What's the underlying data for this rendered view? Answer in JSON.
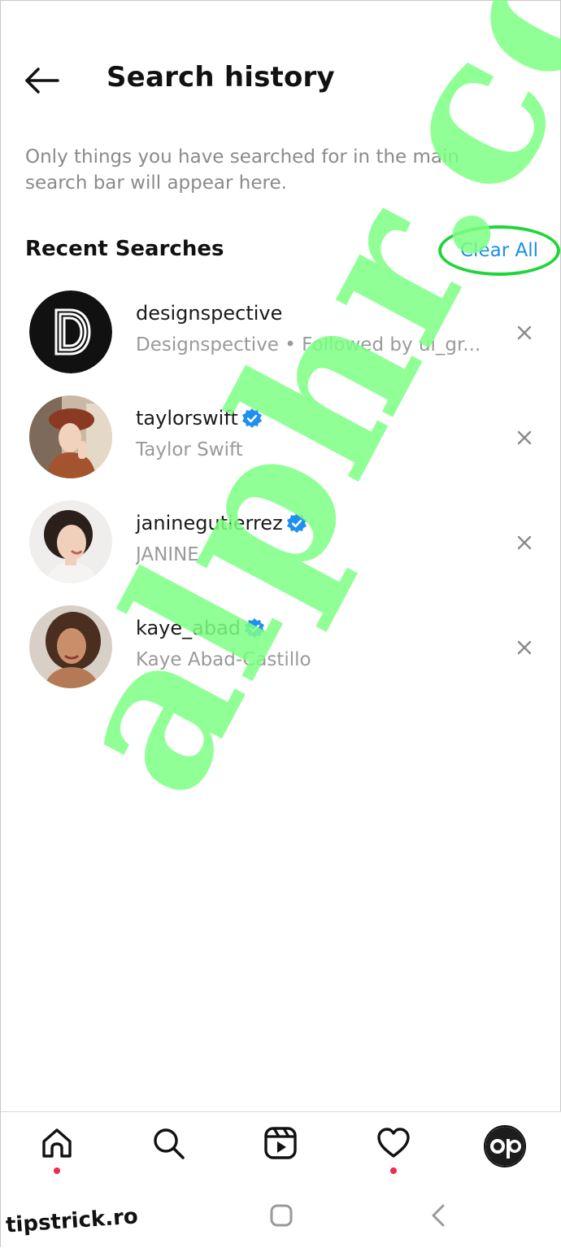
{
  "header": {
    "title": "Search history",
    "back_icon": "arrow-left-icon"
  },
  "description": "Only things you have searched for in the main search bar will appear here.",
  "recent": {
    "title": "Recent Searches",
    "clear_all_label": "Clear All",
    "accent_color": "#1a8fe0",
    "highlight_color": "#1ed63a"
  },
  "results": [
    {
      "username": "designspective",
      "subtitle": "Designspective • Followed by ui_gr...",
      "verified": false,
      "avatar": "designspective-logo"
    },
    {
      "username": "taylorswift",
      "subtitle": "Taylor Swift",
      "verified": true,
      "avatar": "profile-photo"
    },
    {
      "username": "janinegutierrez",
      "subtitle": "JANINE",
      "verified": true,
      "avatar": "profile-photo"
    },
    {
      "username": "kaye_abad",
      "subtitle": "Kaye Abad-Castillo",
      "verified": true,
      "avatar": "profile-photo"
    }
  ],
  "bottom_nav": {
    "items": [
      {
        "icon": "home-icon",
        "notification": true
      },
      {
        "icon": "search-icon",
        "notification": false
      },
      {
        "icon": "reels-icon",
        "notification": false
      },
      {
        "icon": "heart-icon",
        "notification": true
      },
      {
        "icon": "profile-avatar-icon",
        "notification": false
      }
    ],
    "dot_color": "#ef2a4a"
  },
  "system_nav": {
    "items": [
      "recent-apps-icon",
      "home-button-icon",
      "back-chevron-icon"
    ]
  },
  "watermark": "alphr.com",
  "site_stamp": "tipstrick.ro"
}
